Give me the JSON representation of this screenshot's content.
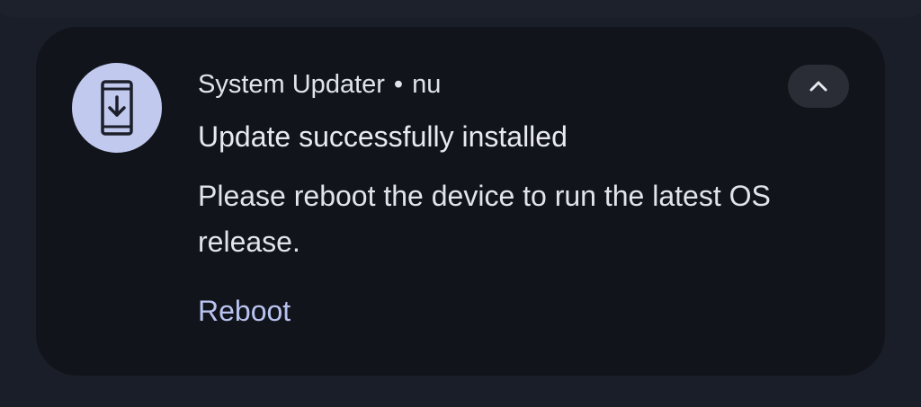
{
  "notification": {
    "app_name": "System Updater",
    "separator": "•",
    "time": "nu",
    "title": "Update successfully installed",
    "body": "Please reboot the device to run the latest OS release.",
    "action_label": "Reboot",
    "app_icon": "phone-download-icon",
    "expand_icon": "chevron-up-icon"
  },
  "colors": {
    "background": "#1a1e28",
    "card": "#12141b",
    "icon_bg": "#c1caee",
    "accent": "#b8c3ef",
    "text": "#e2e4eb"
  }
}
